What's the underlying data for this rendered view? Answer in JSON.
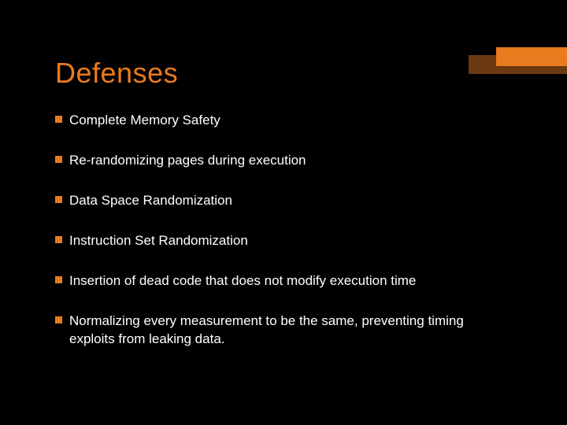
{
  "slide": {
    "title": "Defenses",
    "bullets": [
      "Complete Memory Safety",
      "Re-randomizing pages during execution",
      "Data Space Randomization",
      "Instruction Set Randomization",
      "Insertion of dead code that does not modify execution time",
      "Normalizing every measurement to be the same, preventing timing exploits from leaking data."
    ]
  }
}
